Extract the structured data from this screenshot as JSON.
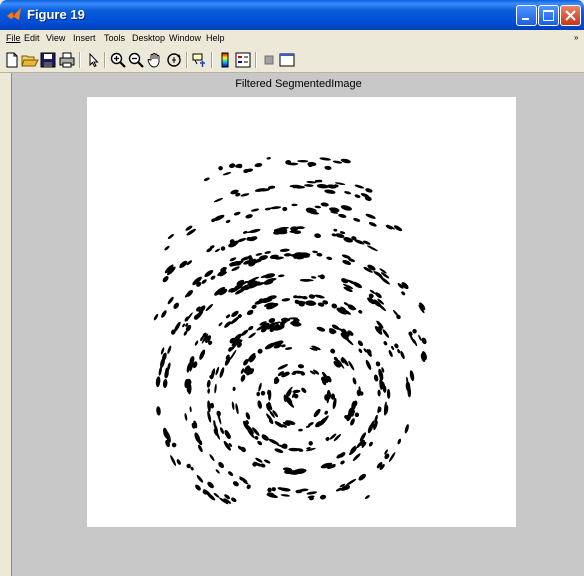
{
  "window": {
    "title": "Figure 19"
  },
  "menu": [
    "File",
    "Edit",
    "View",
    "Insert",
    "Tools",
    "Desktop",
    "Window",
    "Help"
  ],
  "toolbar": {
    "tools": [
      "new-figure",
      "open-file",
      "save-figure",
      "print-figure",
      "edit-plot",
      "zoom-in",
      "zoom-out",
      "pan",
      "rotate-3d",
      "data-cursor",
      "insert-colorbar",
      "insert-legend",
      "hide-plot-tools",
      "show-plot-tools"
    ]
  },
  "figure": {
    "plot_title": "Filtered SegmentedImage"
  },
  "colors": {
    "titlebar": "#0a5fd8",
    "figure_bg": "#c8c8c8",
    "axes_bg": "#ffffff",
    "ink": "#000000"
  }
}
